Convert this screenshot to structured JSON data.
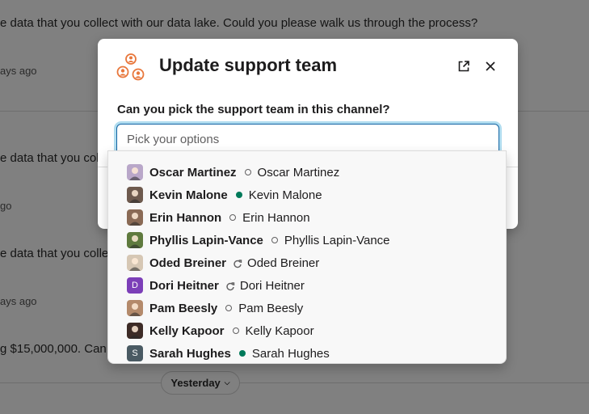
{
  "background": {
    "lines": [
      "e data that you collect with our data lake. Could you please walk us through the process?",
      "e data that you coll",
      "e data that you collec",
      "g $15,000,000. Can"
    ],
    "times": [
      "ays ago",
      "go",
      "ays ago"
    ],
    "date_divider": "Yesterday"
  },
  "modal": {
    "title": "Update support team",
    "question": "Can you pick the support team in this channel?",
    "placeholder": "Pick your options"
  },
  "options": [
    {
      "name": "Oscar Martinez",
      "full": "Oscar Martinez",
      "status": "away",
      "avatar_icon": "oscar-avatar",
      "avatar_color": "#b9a7c9"
    },
    {
      "name": "Kevin Malone",
      "full": "Kevin Malone",
      "status": "active",
      "avatar_icon": "kevin-avatar",
      "avatar_color": "#6e5a4e"
    },
    {
      "name": "Erin Hannon",
      "full": "Erin Hannon",
      "status": "away",
      "avatar_icon": "erin-avatar",
      "avatar_color": "#8a6a55"
    },
    {
      "name": "Phyllis Lapin-Vance",
      "full": "Phyllis Lapin-Vance",
      "status": "away",
      "avatar_icon": "phyllis-avatar",
      "avatar_color": "#5f7a3e"
    },
    {
      "name": "Oded Breiner",
      "full": "Oded Breiner",
      "status": "dnd",
      "avatar_icon": "oded-avatar",
      "avatar_color": "#d6c7b4"
    },
    {
      "name": "Dori Heitner",
      "full": "Dori Heitner",
      "status": "dnd",
      "avatar_icon": "dori-avatar",
      "avatar_letter": "D",
      "avatar_color": "#7c3fb8"
    },
    {
      "name": "Pam Beesly",
      "full": "Pam Beesly",
      "status": "away",
      "avatar_icon": "pam-avatar",
      "avatar_color": "#b48a6b"
    },
    {
      "name": "Kelly Kapoor",
      "full": "Kelly Kapoor",
      "status": "away",
      "avatar_icon": "kelly-avatar",
      "avatar_color": "#3d2b26"
    },
    {
      "name": "Sarah Hughes",
      "full": "Sarah Hughes",
      "status": "active",
      "avatar_icon": "sarah-avatar",
      "avatar_letter": "S",
      "avatar_color": "#4a5a63"
    }
  ],
  "colors": {
    "accent": "#1264a3",
    "active": "#007a5a",
    "brand_orange": "#e8773c"
  }
}
